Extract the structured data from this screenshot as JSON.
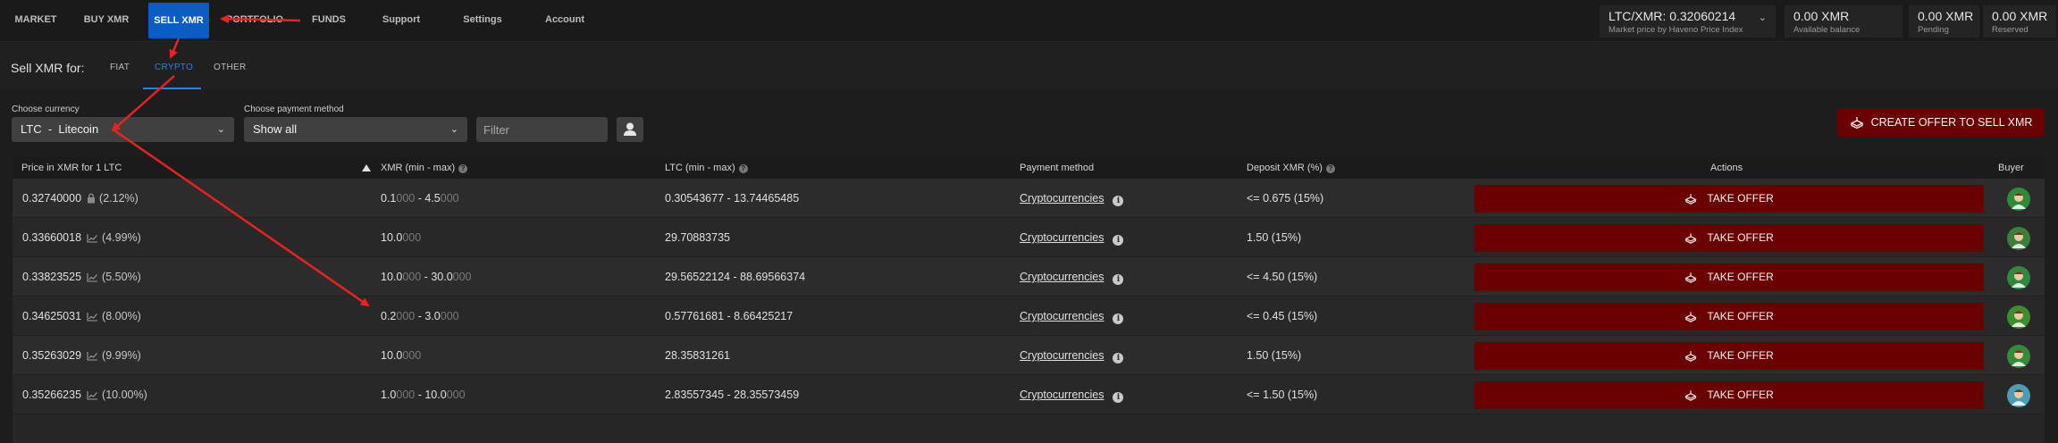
{
  "nav": {
    "items": [
      {
        "label": "MARKET"
      },
      {
        "label": "BUY XMR"
      },
      {
        "label": "SELL XMR"
      },
      {
        "label": "PORTFOLIO"
      },
      {
        "label": "FUNDS"
      },
      {
        "label": "Support"
      },
      {
        "label": "Settings"
      },
      {
        "label": "Account"
      }
    ]
  },
  "market": {
    "pair_price": "LTC/XMR: 0.32060214",
    "pair_sub": "Market price by Haveno Price Index",
    "available_value": "0.00 XMR",
    "available_label": "Available balance",
    "pending_value": "0.00 XMR",
    "pending_label": "Pending",
    "reserved_value": "0.00 XMR",
    "reserved_label": "Reserved"
  },
  "subnav": {
    "title": "Sell XMR for:",
    "tabs": [
      {
        "label": "FIAT"
      },
      {
        "label": "CRYPTO"
      },
      {
        "label": "OTHER"
      }
    ]
  },
  "filters": {
    "currency_label": "Choose currency",
    "currency_value": "LTC  -  Litecoin",
    "payment_label": "Choose payment method",
    "payment_value": "Show all",
    "filter_placeholder": "Filter"
  },
  "create_button": "CREATE OFFER TO SELL XMR",
  "table": {
    "headers": {
      "price": "Price in XMR for 1 LTC",
      "xmr": "XMR (min - max)",
      "ltc": "LTC (min - max)",
      "payment": "Payment method",
      "deposit": "Deposit XMR (%)",
      "actions": "Actions",
      "buyer": "Buyer"
    },
    "rows": [
      {
        "price": "0.32740000",
        "pct": "(2.12%)",
        "xmr_a": "0.1",
        "xmr_a_dim": "000",
        "sep": " - ",
        "xmr_b": "4.5",
        "xmr_b_dim": "000",
        "ltc": "0.30543677 - 13.74465485",
        "payment": "Cryptocurrencies",
        "deposit": "<= 0.675 (15%)",
        "action": "TAKE OFFER"
      },
      {
        "price": "0.33660018",
        "pct": "(4.99%)",
        "xmr_a": "10.0",
        "xmr_a_dim": "000",
        "sep": "",
        "xmr_b": "",
        "xmr_b_dim": "",
        "ltc": "29.70883735",
        "payment": "Cryptocurrencies",
        "deposit": "1.50 (15%)",
        "action": "TAKE OFFER"
      },
      {
        "price": "0.33823525",
        "pct": "(5.50%)",
        "xmr_a": "10.0",
        "xmr_a_dim": "000",
        "sep": " - ",
        "xmr_b": "30.0",
        "xmr_b_dim": "000",
        "ltc": "29.56522124 - 88.69566374",
        "payment": "Cryptocurrencies",
        "deposit": "<= 4.50 (15%)",
        "action": "TAKE OFFER"
      },
      {
        "price": "0.34625031",
        "pct": "(8.00%)",
        "xmr_a": "0.2",
        "xmr_a_dim": "000",
        "sep": " - ",
        "xmr_b": "3.0",
        "xmr_b_dim": "000",
        "ltc": "0.57761681 - 8.66425217",
        "payment": "Cryptocurrencies",
        "deposit": "<= 0.45 (15%)",
        "action": "TAKE OFFER"
      },
      {
        "price": "0.35263029",
        "pct": "(9.99%)",
        "xmr_a": "10.0",
        "xmr_a_dim": "000",
        "sep": "",
        "xmr_b": "",
        "xmr_b_dim": "",
        "ltc": "28.35831261",
        "payment": "Cryptocurrencies",
        "deposit": "1.50 (15%)",
        "action": "TAKE OFFER"
      },
      {
        "price": "0.35266235",
        "pct": "(10.00%)",
        "xmr_a": "1.0",
        "xmr_a_dim": "000",
        "sep": " - ",
        "xmr_b": "10.0",
        "xmr_b_dim": "000",
        "ltc": "2.83557345 - 28.35573459",
        "payment": "Cryptocurrencies",
        "deposit": "<= 1.50 (15%)",
        "action": "TAKE OFFER"
      }
    ]
  },
  "colors": {
    "accent_blue": "#0b5cc3",
    "take_offer_red": "#690101",
    "annotation_red": "#e8231f"
  },
  "icons": {
    "row_first_price": "lock-icon",
    "row_price": "chart-icon",
    "payment_info": "info-icon",
    "take_offer": "take-offer-icon",
    "buyer": "avatar-icon"
  }
}
